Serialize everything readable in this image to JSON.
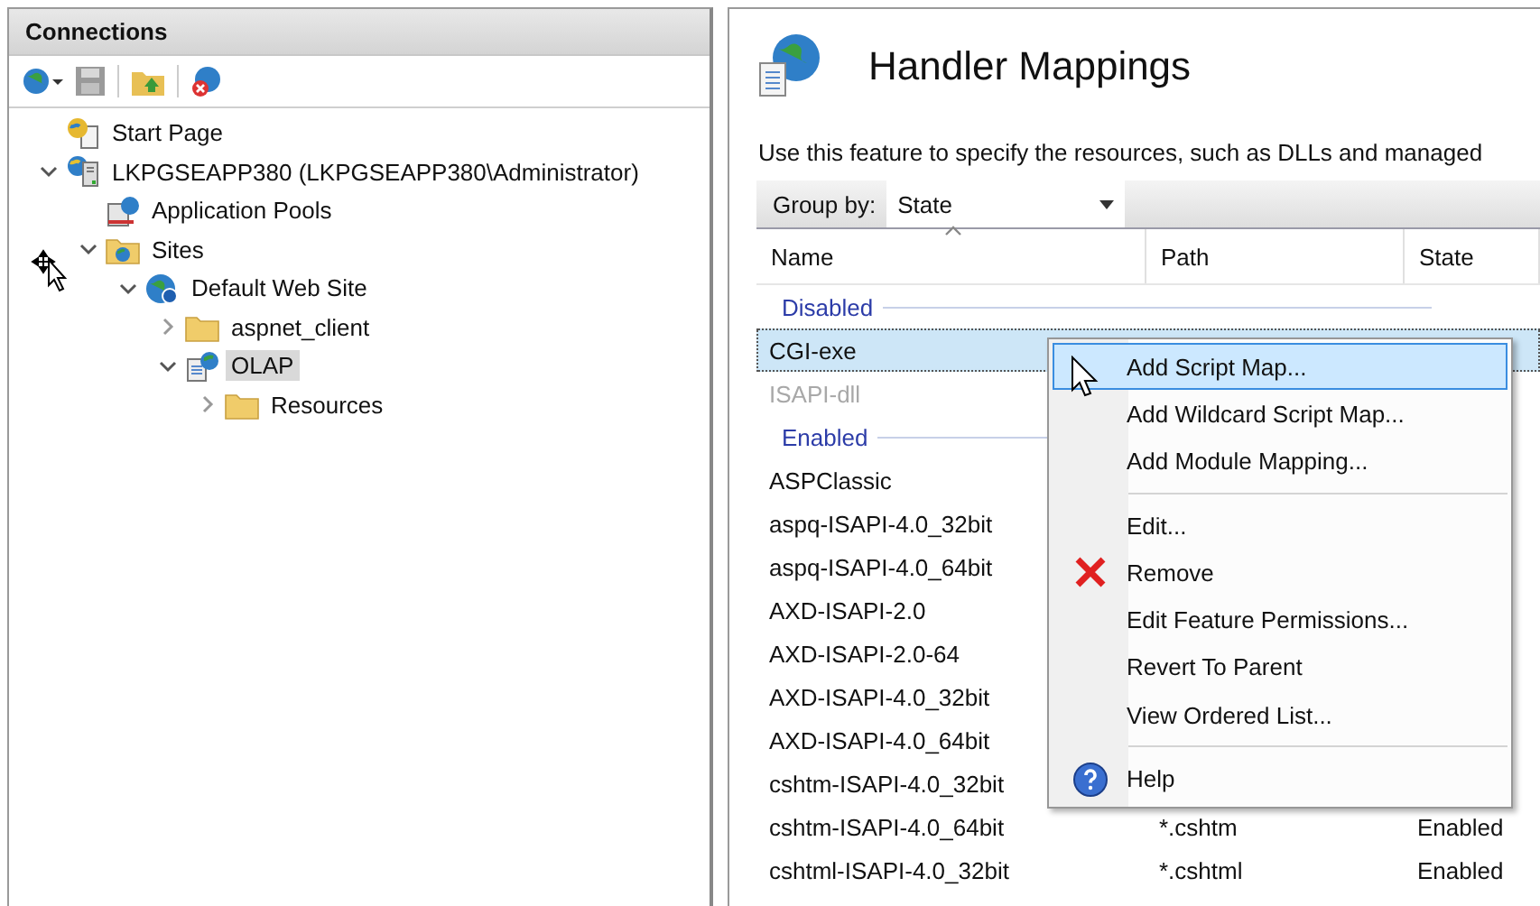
{
  "connections": {
    "title": "Connections",
    "tree": [
      {
        "label": "Start Page",
        "kind": "start",
        "selected": false
      },
      {
        "label": "LKPGSEAPP380 (LKPGSEAPP380\\Administrator)",
        "kind": "server",
        "expanded": true,
        "selected": false,
        "children": [
          {
            "label": "Application Pools",
            "kind": "pools",
            "selected": false
          },
          {
            "label": "Sites",
            "kind": "sites",
            "expanded": true,
            "selected": false,
            "children": [
              {
                "label": "Default Web Site",
                "kind": "website",
                "expanded": true,
                "selected": false,
                "children": [
                  {
                    "label": "aspnet_client",
                    "kind": "folder",
                    "expanded": false,
                    "selected": false
                  },
                  {
                    "label": "OLAP",
                    "kind": "app",
                    "expanded": true,
                    "selected": true,
                    "children": [
                      {
                        "label": "Resources",
                        "kind": "folder",
                        "expanded": false,
                        "selected": false
                      }
                    ]
                  }
                ]
              }
            ]
          }
        ]
      }
    ]
  },
  "feature": {
    "title": "Handler Mappings",
    "description": "Use this feature to specify the resources, such as DLLs and managed",
    "group_by": {
      "label": "Group by:",
      "value": "State"
    },
    "columns": [
      "Name",
      "Path",
      "State"
    ],
    "rows": [
      {
        "kind": "group",
        "label": "Disabled"
      },
      {
        "kind": "item",
        "name": "CGI-exe",
        "selected": true,
        "disabled": false
      },
      {
        "kind": "item",
        "name": "ISAPI-dll",
        "selected": false,
        "disabled": true
      },
      {
        "kind": "group",
        "label": "Enabled"
      },
      {
        "kind": "item",
        "name": "ASPClassic",
        "selected": false,
        "disabled": false
      },
      {
        "kind": "item",
        "name": "aspq-ISAPI-4.0_32bit",
        "selected": false,
        "disabled": false
      },
      {
        "kind": "item",
        "name": "aspq-ISAPI-4.0_64bit",
        "selected": false,
        "disabled": false
      },
      {
        "kind": "item",
        "name": "AXD-ISAPI-2.0",
        "selected": false,
        "disabled": false
      },
      {
        "kind": "item",
        "name": "AXD-ISAPI-2.0-64",
        "selected": false,
        "disabled": false
      },
      {
        "kind": "item",
        "name": "AXD-ISAPI-4.0_32bit",
        "selected": false,
        "disabled": false
      },
      {
        "kind": "item",
        "name": "AXD-ISAPI-4.0_64bit",
        "selected": false,
        "disabled": false
      },
      {
        "kind": "item",
        "name": "cshtm-ISAPI-4.0_32bit",
        "selected": false,
        "disabled": false
      },
      {
        "kind": "item",
        "name": "cshtm-ISAPI-4.0_64bit",
        "path": "*.cshtm",
        "state": "Enabled",
        "selected": false,
        "disabled": false
      },
      {
        "kind": "item",
        "name": "cshtml-ISAPI-4.0_32bit",
        "path": "*.cshtml",
        "state": "Enabled",
        "selected": false,
        "disabled": false
      }
    ]
  },
  "context_menu": [
    {
      "kind": "item",
      "label": "Add Script Map...",
      "selected": true
    },
    {
      "kind": "item",
      "label": "Add Wildcard Script Map...",
      "selected": false
    },
    {
      "kind": "item",
      "label": "Add Module Mapping...",
      "selected": false
    },
    {
      "kind": "separator"
    },
    {
      "kind": "item",
      "label": "Edit...",
      "selected": false
    },
    {
      "kind": "remove",
      "label": "Remove",
      "selected": false
    },
    {
      "kind": "item",
      "label": "Edit Feature Permissions...",
      "selected": false
    },
    {
      "kind": "item",
      "label": "Revert To Parent",
      "selected": false
    },
    {
      "kind": "item",
      "label": "View Ordered List...",
      "selected": false
    },
    {
      "kind": "separator"
    },
    {
      "kind": "help",
      "label": "Help",
      "selected": false
    }
  ]
}
